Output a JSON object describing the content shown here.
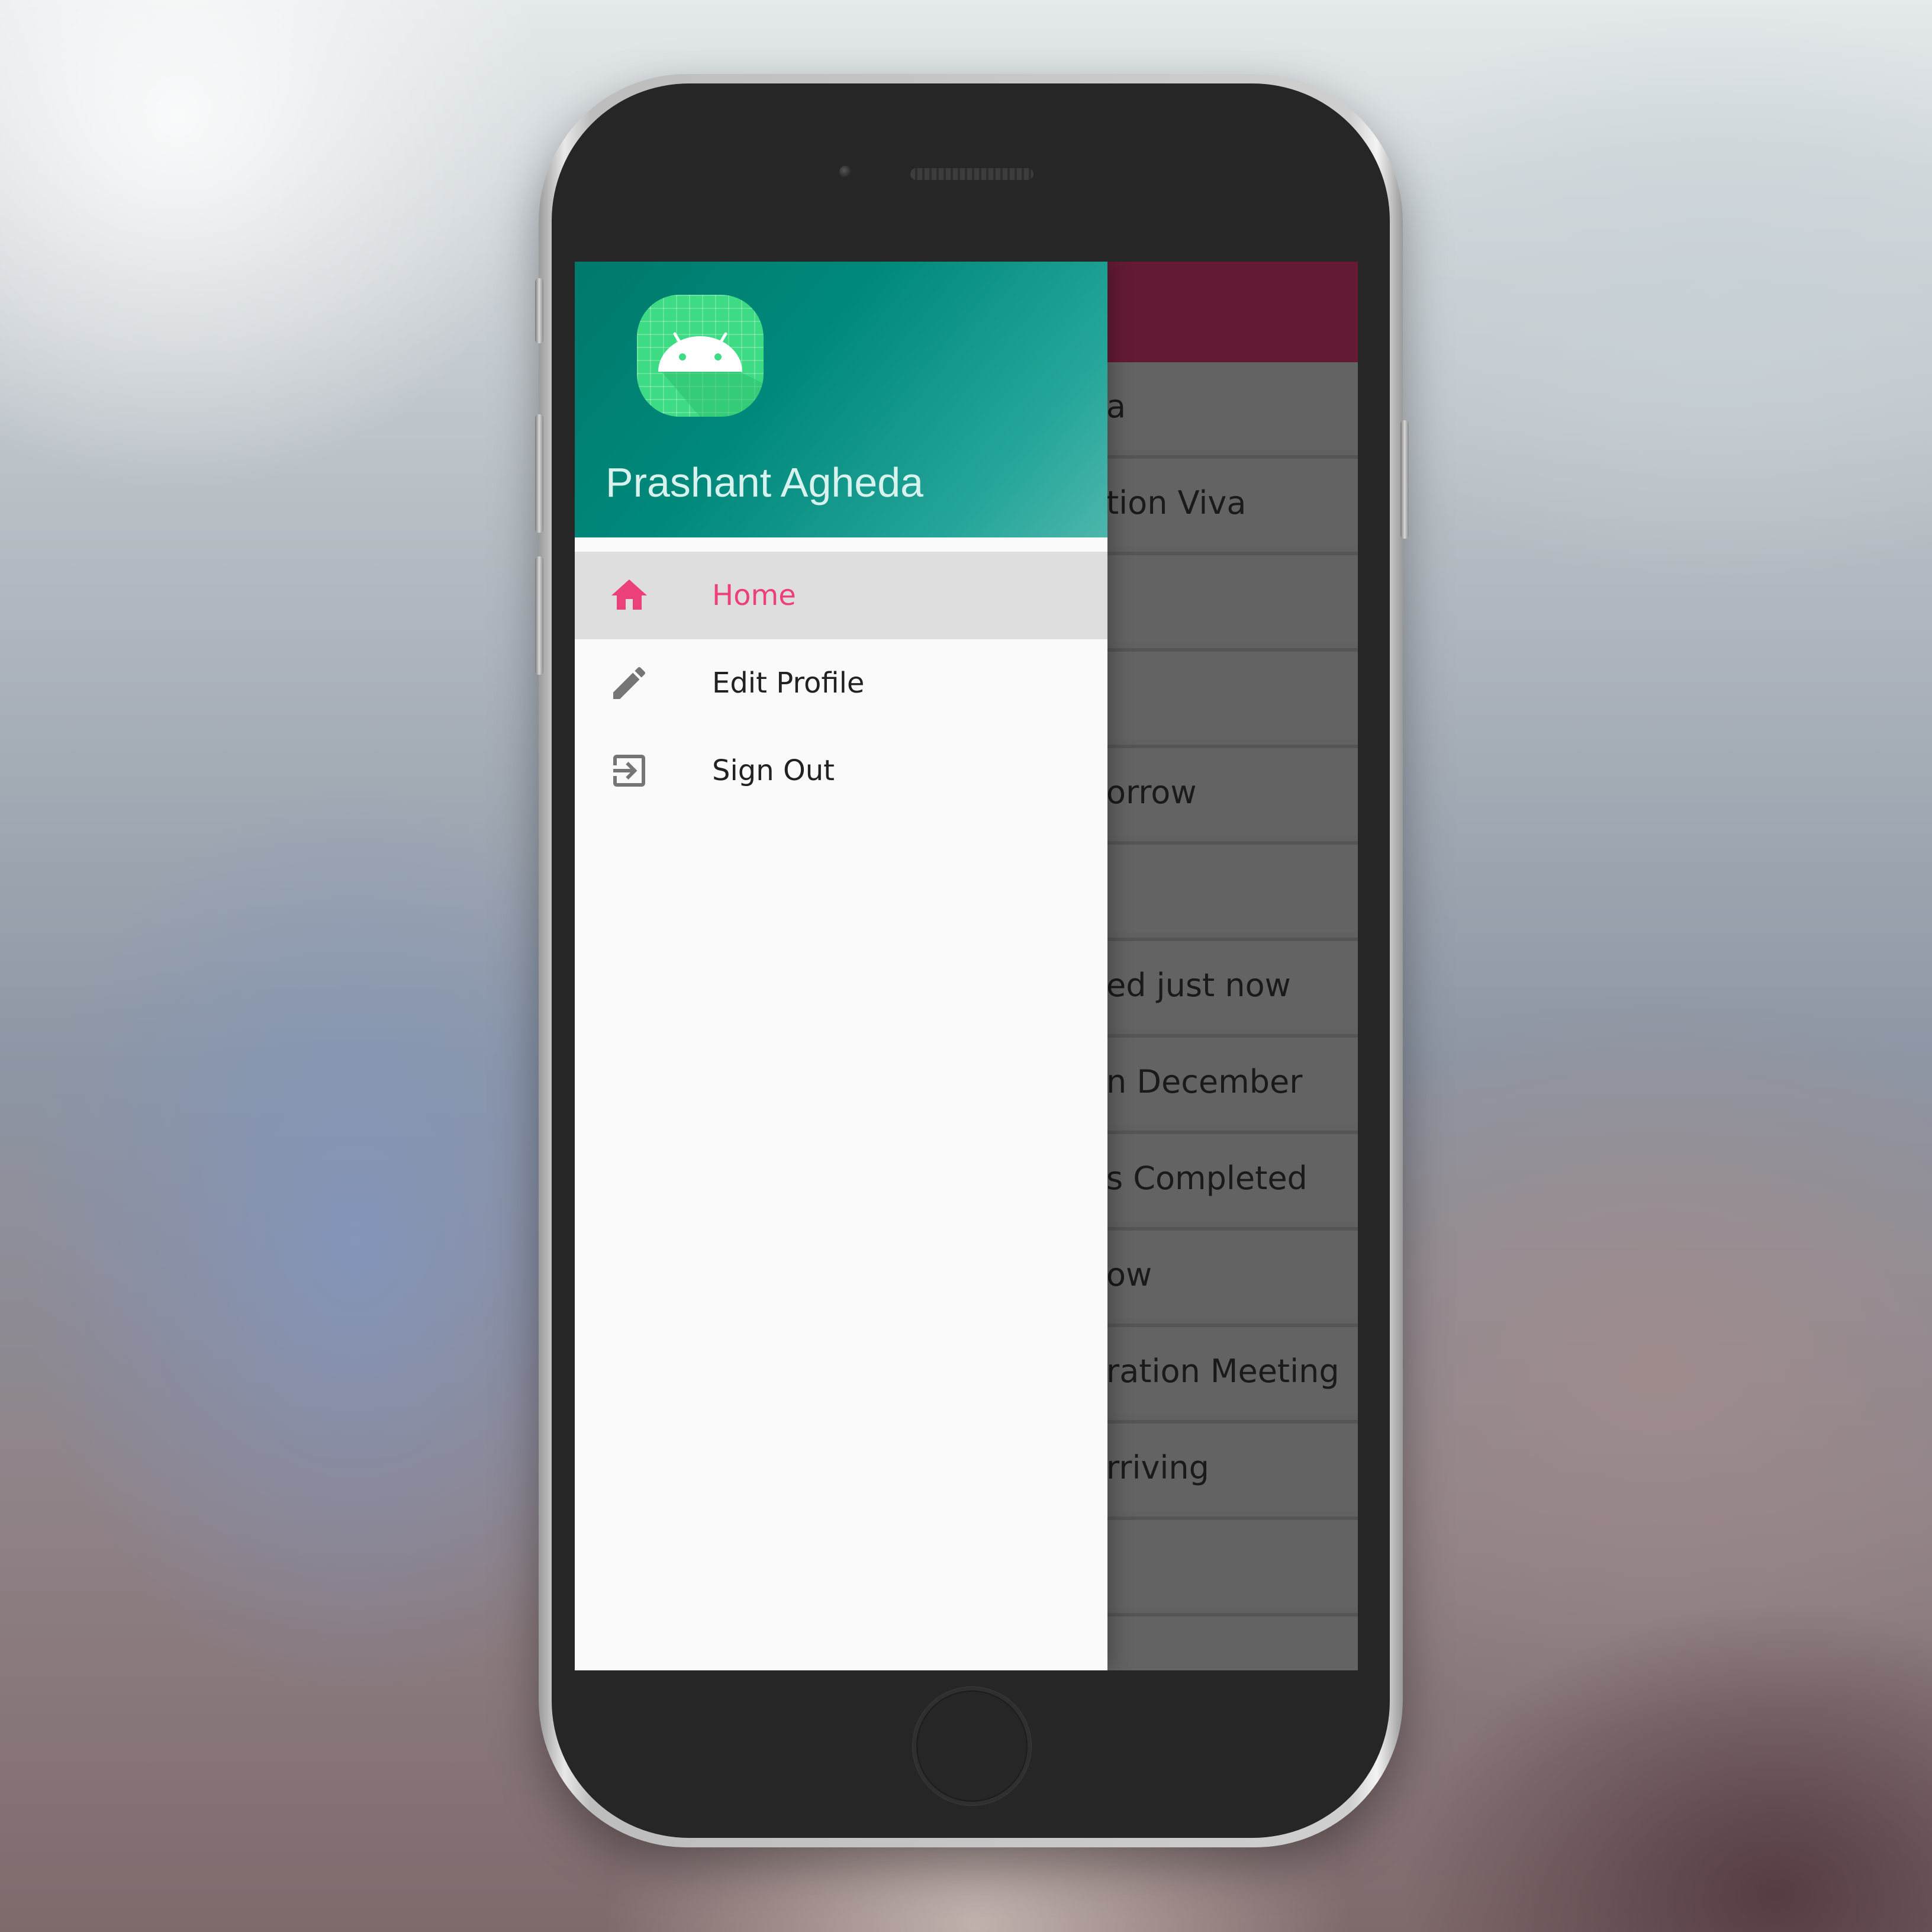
{
  "drawer": {
    "user_name": "Prashant Agheda",
    "menu": [
      {
        "label": "Home",
        "icon": "home-icon",
        "active": true,
        "color": "#ec407a"
      },
      {
        "label": "Edit Profile",
        "icon": "pencil-icon",
        "active": false
      },
      {
        "label": "Sign Out",
        "icon": "sign-out-icon",
        "active": false
      }
    ],
    "header_colors": [
      "#00796b",
      "#4db6ac"
    ],
    "logo_color": "#3ddc84"
  },
  "background_app": {
    "toolbar_color": "#641a34",
    "rows": [
      "a",
      "tion Viva",
      "",
      "",
      "orrow",
      "",
      "ed just now",
      "n December",
      "s Completed",
      "ow",
      "ration Meeting",
      "rriving",
      "",
      ""
    ]
  }
}
